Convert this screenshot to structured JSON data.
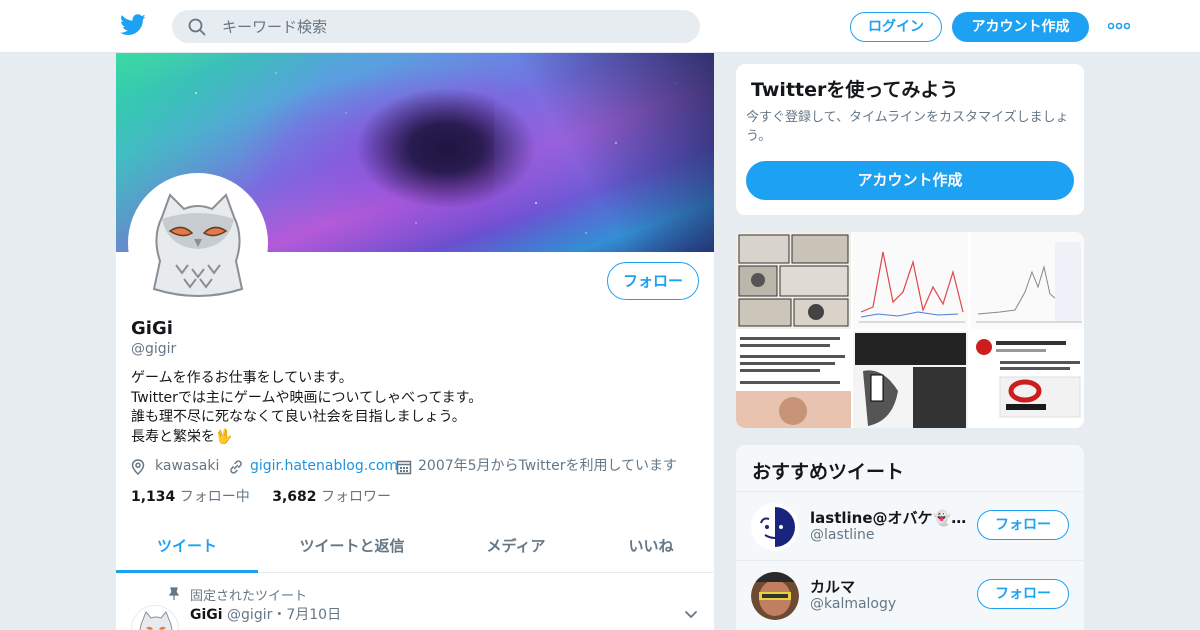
{
  "nav": {
    "search_placeholder": "キーワード検索",
    "login_label": "ログイン",
    "signup_label": "アカウント作成",
    "brand_color": "#1da1f2"
  },
  "profile": {
    "name": "GiGi",
    "handle": "@gigir",
    "follow_label": "フォロー",
    "bio": [
      "ゲームを作るお仕事をしています。",
      "Twitterでは主にゲームや映画についてしゃべってます。",
      "誰も理不尽に死ななくて良い社会を目指しましょう。",
      "長寿と繁栄を🖖"
    ],
    "location": "kawasaki",
    "website": "gigir.hatenablog.com",
    "joined": "2007年5月からTwitterを利用しています",
    "following_count": "1,134",
    "following_label": "フォロー中",
    "followers_count": "3,682",
    "followers_label": "フォロワー"
  },
  "tabs": [
    {
      "label": "ツイート",
      "active": true
    },
    {
      "label": "ツイートと返信",
      "active": false
    },
    {
      "label": "メディア",
      "active": false
    },
    {
      "label": "いいね",
      "active": false
    }
  ],
  "pinned_tweet": {
    "pinned_label": "固定されたツイート",
    "author_name": "GiGi",
    "author_handle": "@gigir",
    "separator": "・",
    "date": "7月10日"
  },
  "signup_card": {
    "title": "Twitterを使ってみよう",
    "description": "今すぐ登録して、タイムラインをカスタマイズしましょう。",
    "button_label": "アカウント作成"
  },
  "recommendations": {
    "title": "おすすめツイート",
    "items": [
      {
        "name": "lastline@オバケ👻フ...",
        "handle": "@lastline",
        "follow_label": "フォロー"
      },
      {
        "name": "カルマ",
        "handle": "@kalmalogy",
        "follow_label": "フォロー"
      }
    ]
  }
}
